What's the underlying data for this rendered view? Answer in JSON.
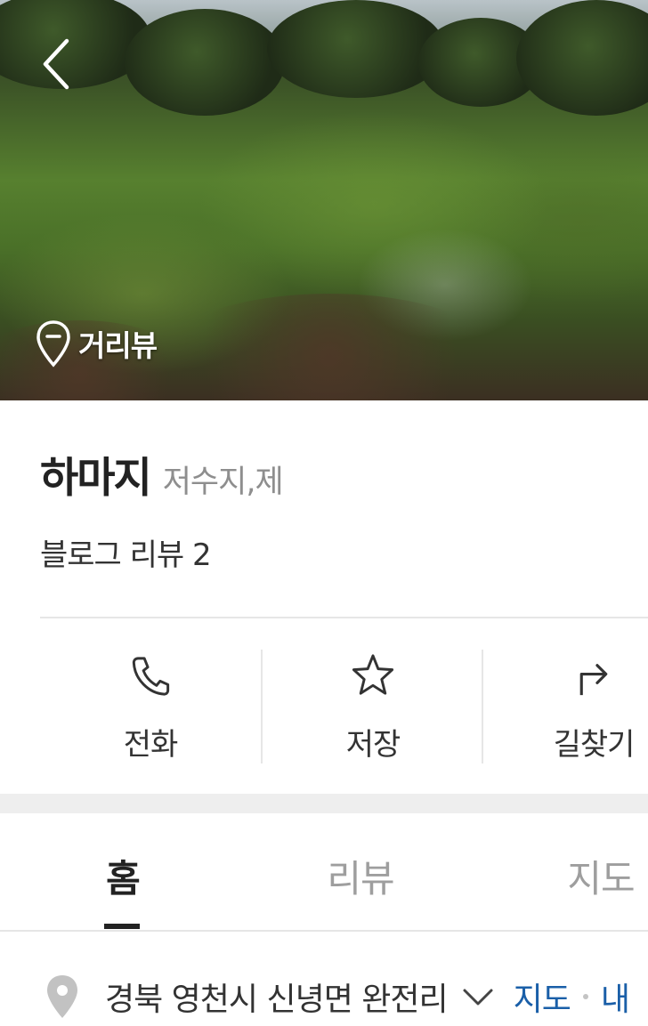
{
  "hero": {
    "streetview_label": "거리뷰"
  },
  "place": {
    "name": "하마지",
    "category": "저수지,제",
    "blog_review": "블로그 리뷰 2"
  },
  "actions": [
    {
      "label": "전화",
      "icon": "phone-icon"
    },
    {
      "label": "저장",
      "icon": "star-icon"
    },
    {
      "label": "길찾기",
      "icon": "directions-icon"
    }
  ],
  "tabs": [
    {
      "label": "홈",
      "active": true
    },
    {
      "label": "리뷰",
      "active": false
    },
    {
      "label": "지도",
      "active": false
    }
  ],
  "address": {
    "text": "경북 영천시 신녕면 완전리",
    "map_link": "지도",
    "more_link": "내"
  },
  "colors": {
    "link": "#1a5fa8",
    "inactive_tab": "#9e9e9e",
    "divider": "#e6e6e6",
    "band": "#eeeeee"
  }
}
